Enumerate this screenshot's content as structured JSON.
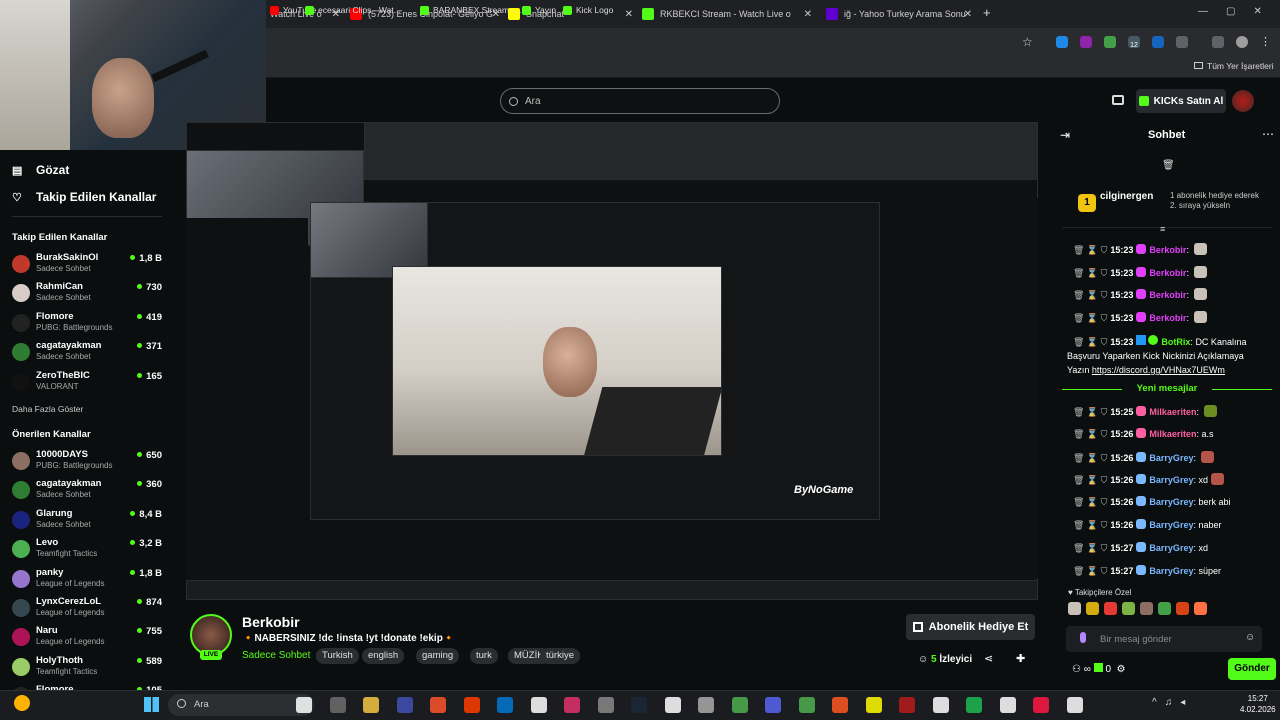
{
  "browser": {
    "tabs": [
      {
        "label": "Watch Live o",
        "color": "#53fc18"
      },
      {
        "label": "(5723) Enes Cinpolat- Geliyo G",
        "color": "#ff0000"
      },
      {
        "label": "Snapchat",
        "color": "#fffc00"
      },
      {
        "label": "RKBEKCI Stream - Watch Live o",
        "color": "#53fc18"
      },
      {
        "label": "iğ - Yahoo Turkey Arama Sonu",
        "color": "#6001d2"
      }
    ],
    "bookmarks": [
      {
        "label": "YouTube",
        "color": "#ff0000"
      },
      {
        "label": "ecesaari Clips - Wat...",
        "color": "#53fc18"
      },
      {
        "label": "BARANBEX Stream -...",
        "color": "#53fc18"
      },
      {
        "label": "Yayın",
        "color": "#53fc18"
      },
      {
        "label": "Kick Logo",
        "color": "#53fc18"
      }
    ],
    "all_bookmarks": "Tüm Yer İşaretleri",
    "extension_badge": "12"
  },
  "header": {
    "search_placeholder": "Ara",
    "kicks_button": "KICKs Satın Al"
  },
  "sidebar": {
    "nav": [
      {
        "label": "Gözat",
        "icon": "browse-icon"
      },
      {
        "label": "Takip Edilen Kanallar",
        "icon": "heart-icon"
      }
    ],
    "followed_heading": "Takip Edilen Kanallar",
    "followed": [
      {
        "name": "BurakSakinOl",
        "category": "Sadece Sohbet",
        "viewers": "1,8 B",
        "color": "#c0392b"
      },
      {
        "name": "RahmiCan",
        "category": "Sadece Sohbet",
        "viewers": "730",
        "color": "#d7ccc8"
      },
      {
        "name": "Flomore",
        "category": "PUBG: Battlegrounds",
        "viewers": "419",
        "color": "#222222"
      },
      {
        "name": "cagatayakman",
        "category": "Sadece Sohbet",
        "viewers": "371",
        "color": "#2e7d32"
      },
      {
        "name": "ZeroTheBIC",
        "category": "VALORANT",
        "viewers": "165",
        "color": "#111111"
      }
    ],
    "show_more": "Daha Fazla Göster",
    "recommended_heading": "Önerilen Kanallar",
    "recommended": [
      {
        "name": "10000DAYS",
        "category": "PUBG: Battlegrounds",
        "viewers": "650",
        "color": "#8d6e63"
      },
      {
        "name": "cagatayakman",
        "category": "Sadece Sohbet",
        "viewers": "360",
        "color": "#2e7d32"
      },
      {
        "name": "Glarung",
        "category": "Sadece Sohbet",
        "viewers": "8,4 B",
        "color": "#1a237e"
      },
      {
        "name": "Levo",
        "category": "Teamfight Tactics",
        "viewers": "3,2 B",
        "color": "#4caf50"
      },
      {
        "name": "panky",
        "category": "League of Legends",
        "viewers": "1,8 B",
        "color": "#9575cd"
      },
      {
        "name": "LynxCerezLoL",
        "category": "League of Legends",
        "viewers": "874",
        "color": "#37474f"
      },
      {
        "name": "Naru",
        "category": "League of Legends",
        "viewers": "755",
        "color": "#ad1457"
      },
      {
        "name": "HolyThoth",
        "category": "Teamfight Tactics",
        "viewers": "589",
        "color": "#9ccc65"
      },
      {
        "name": "Flomore",
        "category": "",
        "viewers": "105",
        "color": "#222222"
      }
    ]
  },
  "stream": {
    "streamer": "Berkobir",
    "live": "LIVE",
    "title": "🔸NABERSINIZ !dc !insta !yt !donate !ekip🔸",
    "category": "Sadece Sohbet",
    "tags": [
      "Turkish",
      "english",
      "gaming",
      "turk",
      "MÜZİK",
      "türkiye"
    ],
    "subscribe_gift": "Abonelik Hediye Et",
    "viewers_count": "5",
    "viewers_label": "İzleyici",
    "overlay_logo": "ByNoGame"
  },
  "chat": {
    "title": "Sohbet",
    "pinned_user": "cilginergen",
    "pinned_text": "1 abonelik hediye ederek 2. sıraya yükseln",
    "messages_before": [
      {
        "time": "15:23",
        "user": "Berkobir",
        "text": "",
        "usercolor": "#e040fb",
        "emote": "#c9c2b8"
      },
      {
        "time": "15:23",
        "user": "Berkobir",
        "text": "",
        "usercolor": "#e040fb",
        "emote": "#c9c2b8"
      },
      {
        "time": "15:23",
        "user": "Berkobir",
        "text": "",
        "usercolor": "#e040fb",
        "emote": "#c9c2b8"
      },
      {
        "time": "15:23",
        "user": "Berkobir",
        "text": "",
        "usercolor": "#e040fb",
        "emote": "#c9c2b8"
      }
    ],
    "botrix": {
      "time": "15:23",
      "user": "BotRix",
      "line1": "DC Kanalına",
      "line2": "Başvuru Yaparken Kick Nickinizi Açıklamaya",
      "line3_prefix": "Yazın",
      "link": "https://discord.gg/VHNax7UEWm"
    },
    "new_messages": "Yeni mesajlar",
    "messages_after": [
      {
        "time": "15:25",
        "user": "Milkaeriten",
        "text": "",
        "usercolor": "#ff5fa2",
        "emote": "#6b8e23"
      },
      {
        "time": "15:26",
        "user": "Milkaeriten",
        "text": "a.s",
        "usercolor": "#ff5fa2",
        "emote": ""
      },
      {
        "time": "15:26",
        "user": "BarryGrey",
        "text": "",
        "usercolor": "#7ab8ff",
        "emote": "#b5554a"
      },
      {
        "time": "15:26",
        "user": "BarryGrey",
        "text": "xd",
        "usercolor": "#7ab8ff",
        "emote": "#b5554a"
      },
      {
        "time": "15:26",
        "user": "BarryGrey",
        "text": "berk abi",
        "usercolor": "#7ab8ff",
        "emote": ""
      },
      {
        "time": "15:26",
        "user": "BarryGrey",
        "text": "naber",
        "usercolor": "#7ab8ff",
        "emote": ""
      },
      {
        "time": "15:27",
        "user": "BarryGrey",
        "text": "xd",
        "usercolor": "#7ab8ff",
        "emote": ""
      },
      {
        "time": "15:27",
        "user": "BarryGrey",
        "text": "süper",
        "usercolor": "#7ab8ff",
        "emote": ""
      }
    ],
    "emote_row_label": "Takipçilere Özel",
    "input_placeholder": "Bir mesaj gönder",
    "send": "Gönder",
    "kick_count": "0"
  },
  "taskbar": {
    "search": "Ara",
    "time": "15:27",
    "date": "4.02.2026"
  }
}
